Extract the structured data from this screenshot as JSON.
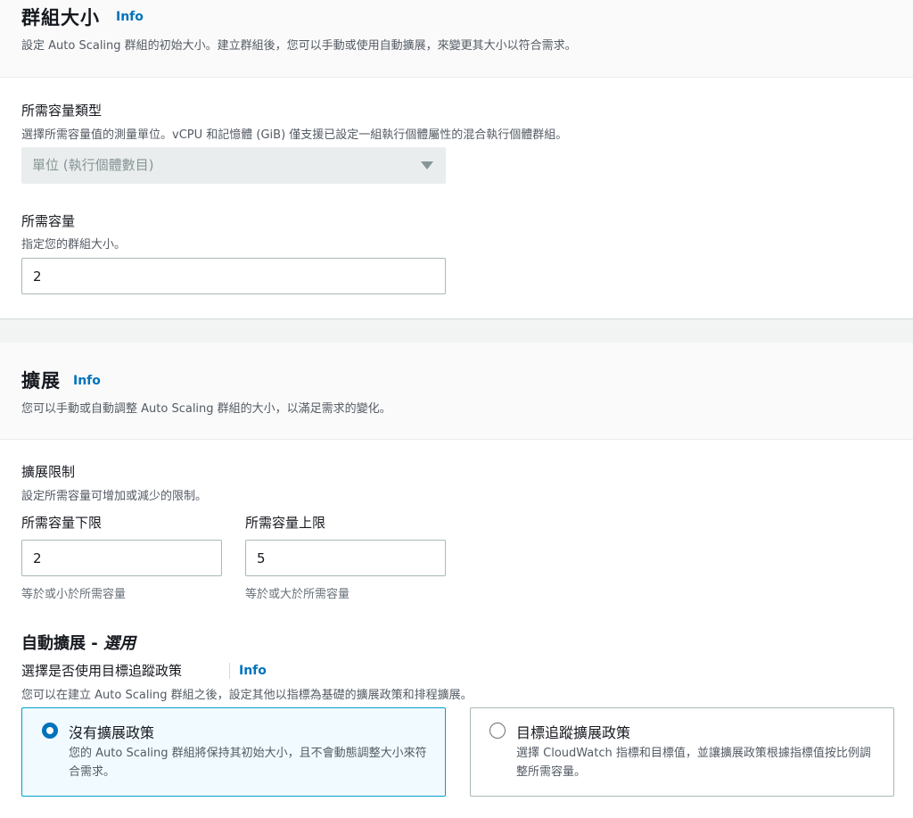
{
  "group_size": {
    "title": "群組大小",
    "info": "Info",
    "description": "設定 Auto Scaling 群組的初始大小。建立群組後，您可以手動或使用自動擴展，來變更其大小以符合需求。",
    "capacity_type": {
      "label": "所需容量類型",
      "description": "選擇所需容量值的測量單位。vCPU 和記憶體 (GiB) 僅支援已設定一組執行個體屬性的混合執行個體群組。",
      "selected": "單位 (執行個體數目)"
    },
    "desired_capacity": {
      "label": "所需容量",
      "description": "指定您的群組大小。",
      "value": "2"
    }
  },
  "scaling": {
    "title": "擴展",
    "info": "Info",
    "description": "您可以手動或自動調整 Auto Scaling 群組的大小，以滿足需求的變化。",
    "limits": {
      "label": "擴展限制",
      "description": "設定所需容量可增加或減少的限制。",
      "min": {
        "label": "所需容量下限",
        "value": "2",
        "constraint": "等於或小於所需容量"
      },
      "max": {
        "label": "所需容量上限",
        "value": "5",
        "constraint": "等於或大於所需容量"
      }
    },
    "auto": {
      "title": "自動擴展 - ",
      "title_optional": "選用",
      "policy_label": "選擇是否使用目標追蹤政策",
      "info": "Info",
      "policy_description": "您可以在建立 Auto Scaling 群組之後，設定其他以指標為基礎的擴展政策和排程擴展。",
      "options": [
        {
          "title": "沒有擴展政策",
          "description": "您的 Auto Scaling 群組將保持其初始大小，且不會動態調整大小來符合需求。",
          "selected": true
        },
        {
          "title": "目標追蹤擴展政策",
          "description": "選擇 CloudWatch 指標和目標值，並讓擴展政策根據指標值按比例調整所需容量。",
          "selected": false
        }
      ]
    }
  },
  "colors": {
    "link": "#0073bb",
    "selected_border": "#00a1c9",
    "selected_bg": "#f1faff"
  }
}
